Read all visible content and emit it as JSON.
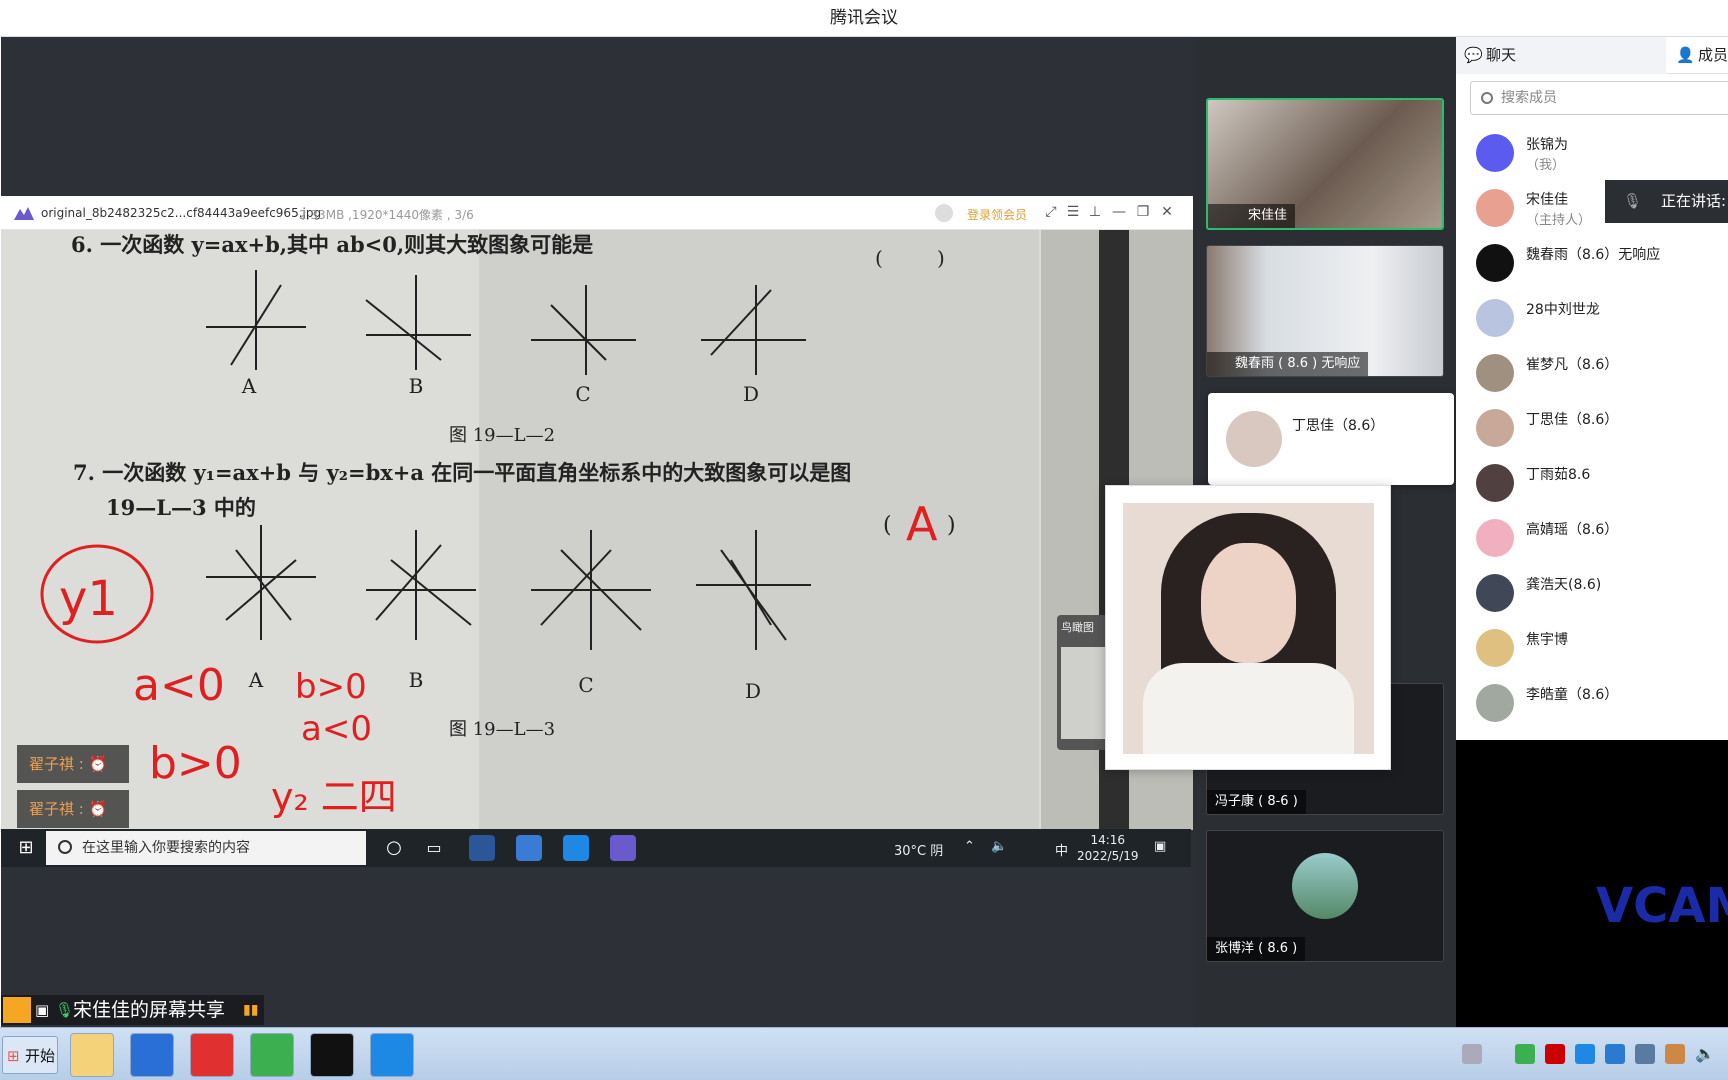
{
  "window_title": "腾讯会议",
  "viewer": {
    "filename": "original_8b2482325c2...cf84443a9eefc965.jpg",
    "meta": "2.33MB ,1920*1440像素 , 3/6",
    "login": "登录领会员"
  },
  "question6": {
    "text": "6. 一次函数 y=ax+b,其中 ab<0,则其大致图象可能是",
    "options": [
      "A",
      "B",
      "C",
      "D"
    ],
    "figure": "图 19—L—2"
  },
  "question7": {
    "text": "7. 一次函数 y₁=ax+b 与 y₂=bx+a 在同一平面直角坐标系中的大致图象可以是图",
    "text2": "19—L—3 中的",
    "answer": "A",
    "options": [
      "A",
      "B",
      "C",
      "D"
    ],
    "figure": "图 19—L—3"
  },
  "handwriting": {
    "circle": "y1",
    "note1": "a<0",
    "note2": "b>0",
    "note3": "b>0",
    "note4": "a<0",
    "note5": "y₂ 二四"
  },
  "reminders": [
    "翟子祺 :",
    "翟子祺 :"
  ],
  "thumbnav_label": "鸟瞰图",
  "win_taskbar": {
    "search_placeholder": "在这里输入你要搜索的内容",
    "weather": "30°C 阴",
    "ime": "中",
    "time": "14:16",
    "date": "2022/5/19"
  },
  "share_banner": "宋佳佳的屏幕共享",
  "video_tiles": [
    {
      "name": "宋佳佳"
    },
    {
      "name": "魏春雨 ( 8.6 ) 无响应"
    },
    {
      "name": "冯子康 ( 8-6 )"
    },
    {
      "name": "张博洋 ( 8.6 )"
    }
  ],
  "hover_card": {
    "name": "丁思佳（8.6）"
  },
  "panel": {
    "tab_chat": "聊天",
    "tab_members": "成员",
    "search_placeholder": "搜索成员",
    "speaking": "正在讲话:"
  },
  "members": [
    {
      "name": "张锦为",
      "sub": "（我）",
      "color": "#5b5bef"
    },
    {
      "name": "宋佳佳",
      "sub": "（主持人）",
      "color": "#e8a090"
    },
    {
      "name": "魏春雨（8.6）无响应",
      "sub": "",
      "color": "#111111"
    },
    {
      "name": "28中刘世龙",
      "sub": "",
      "color": "#b8c4e0"
    },
    {
      "name": "崔梦凡（8.6）",
      "sub": "",
      "color": "#a09080"
    },
    {
      "name": "丁思佳（8.6）",
      "sub": "",
      "color": "#c8a898"
    },
    {
      "name": "丁雨茹8.6",
      "sub": "",
      "color": "#504040"
    },
    {
      "name": "高婧瑶（8.6）",
      "sub": "",
      "color": "#f0b0c0"
    },
    {
      "name": "龚浩天(8.6)",
      "sub": "",
      "color": "#404858"
    },
    {
      "name": "焦宇博",
      "sub": "",
      "color": "#e0c080"
    },
    {
      "name": "李皓童（8.6）",
      "sub": "",
      "color": "#a0a8a0"
    }
  ],
  "win7_taskbar": {
    "start": "开始"
  },
  "vcam": "VCAM"
}
